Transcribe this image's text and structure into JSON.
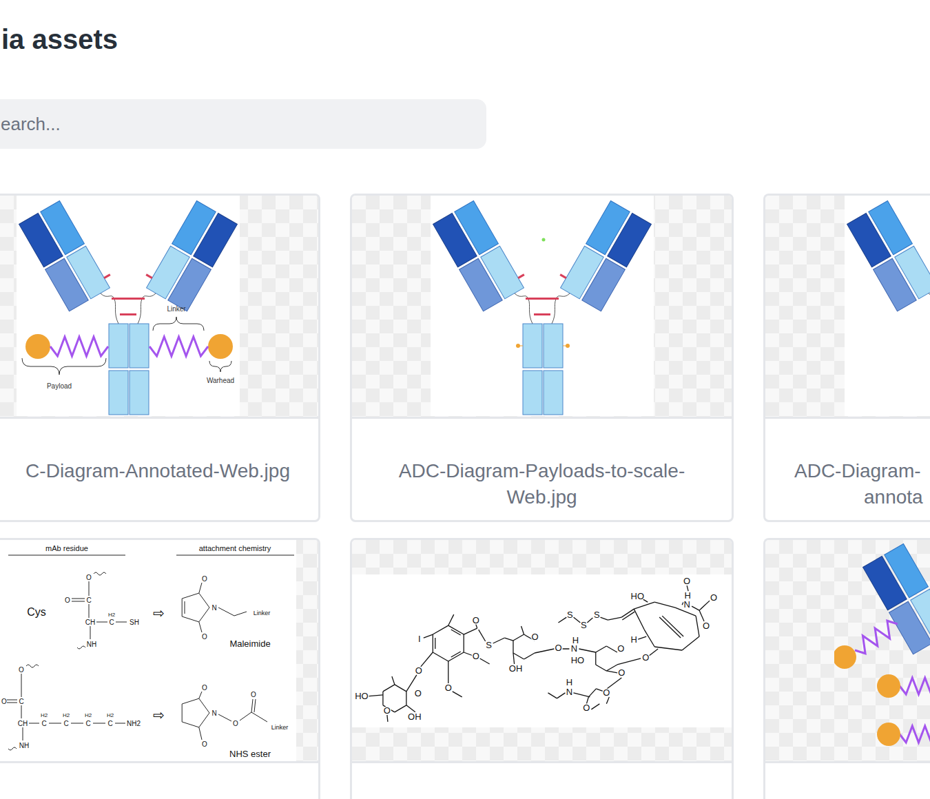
{
  "page": {
    "title": "ia assets"
  },
  "search": {
    "placeholder": "earch..."
  },
  "assets": [
    {
      "kind": "antibody-annotated",
      "caption": [
        "C-Diagram-Annotated-Web.jpg"
      ],
      "labels": [
        "Linker",
        "Payload",
        "Warhead"
      ]
    },
    {
      "kind": "antibody-scale",
      "caption": [
        "ADC-Diagram-Payloads-to-scale-",
        "Web.jpg"
      ],
      "labels": []
    },
    {
      "kind": "antibody-plain",
      "caption": [
        "ADC-Diagram-",
        "annota"
      ],
      "labels": []
    },
    {
      "kind": "chemistry",
      "caption": [],
      "labels": [
        "mAb residue",
        "attachment chemistry",
        "Cys",
        "O",
        "O",
        "C",
        "H2",
        "CH",
        "C",
        "SH",
        "NH",
        "⇨",
        "O",
        "N",
        "Linker",
        "O",
        "Maleimide",
        "O",
        "O",
        "C",
        "H2",
        "H2",
        "H2",
        "H2",
        "CH",
        "C",
        "C",
        "C",
        "C",
        "NH2",
        "NH",
        "⇨",
        "O",
        "N",
        "O",
        "O",
        "Linker",
        "O",
        "NHS ester"
      ]
    },
    {
      "kind": "structure",
      "caption": [],
      "labels": [
        "I",
        "O",
        "S",
        "O",
        "OH",
        "O",
        "H",
        "N",
        "HO",
        "O",
        "O",
        "O",
        "H",
        "N",
        "O",
        "O",
        "O",
        "O",
        "O",
        "HO",
        "O",
        "O",
        "OH",
        "S",
        "S",
        "S",
        "HO",
        "O",
        "H",
        "N",
        "O",
        "O",
        "H"
      ]
    },
    {
      "kind": "antibody-payloads",
      "caption": [],
      "labels": []
    }
  ]
}
